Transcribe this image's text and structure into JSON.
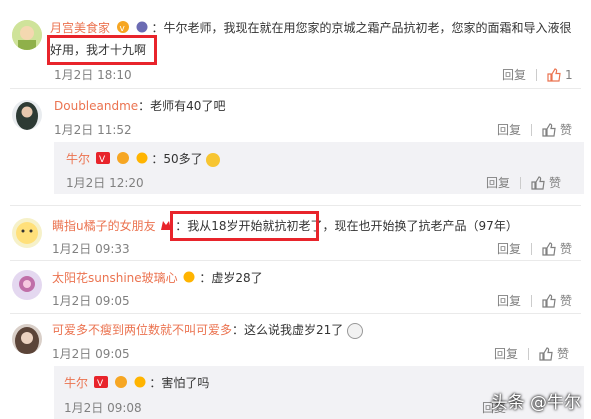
{
  "comments": [
    {
      "user": "月宫美食家",
      "text_a": "：牛尔老师，我现在就在用您家的京城之霜产品抗初老，您家的面霜和导入液很",
      "text_b": "好用，我才十九啊",
      "date": "1月2日 18:10",
      "reply": "回复",
      "likes": "1"
    },
    {
      "user": "Doubleandme",
      "text": "：老师有40了吧",
      "date": "1月2日 11:52",
      "reply": "回复",
      "like_label": "赞",
      "sub": {
        "user": "牛尔",
        "text": "：50多了",
        "date": "1月2日 12:20",
        "reply": "回复",
        "like_label": "赞"
      }
    },
    {
      "user": "瞒指u橘子的女朋友",
      "text_boxed": "：我从18岁开始就抗初老了",
      "text_rest": "，现在也开始换了抗老产品（97年）",
      "date": "1月2日 09:33",
      "reply": "回复",
      "like_label": "赞"
    },
    {
      "user": "太阳花sunshine玻璃心",
      "text": "：虚岁28了",
      "date": "1月2日 09:05",
      "reply": "回复",
      "like_label": "赞"
    },
    {
      "user": "可爱多不瘦到两位数就不叫可爱多",
      "text": "：这么说我虚岁21了",
      "date": "1月2日 09:05",
      "reply": "回复",
      "like_label": "赞",
      "sub": {
        "user": "牛尔",
        "text": "：害怕了吗",
        "date": "1月2日 09:08",
        "reply": "回复"
      }
    }
  ],
  "watermark": "头条 @牛尔",
  "colors": {
    "name": "#eb7350",
    "highlight_box": "#e8242b",
    "meta": "#808080"
  }
}
